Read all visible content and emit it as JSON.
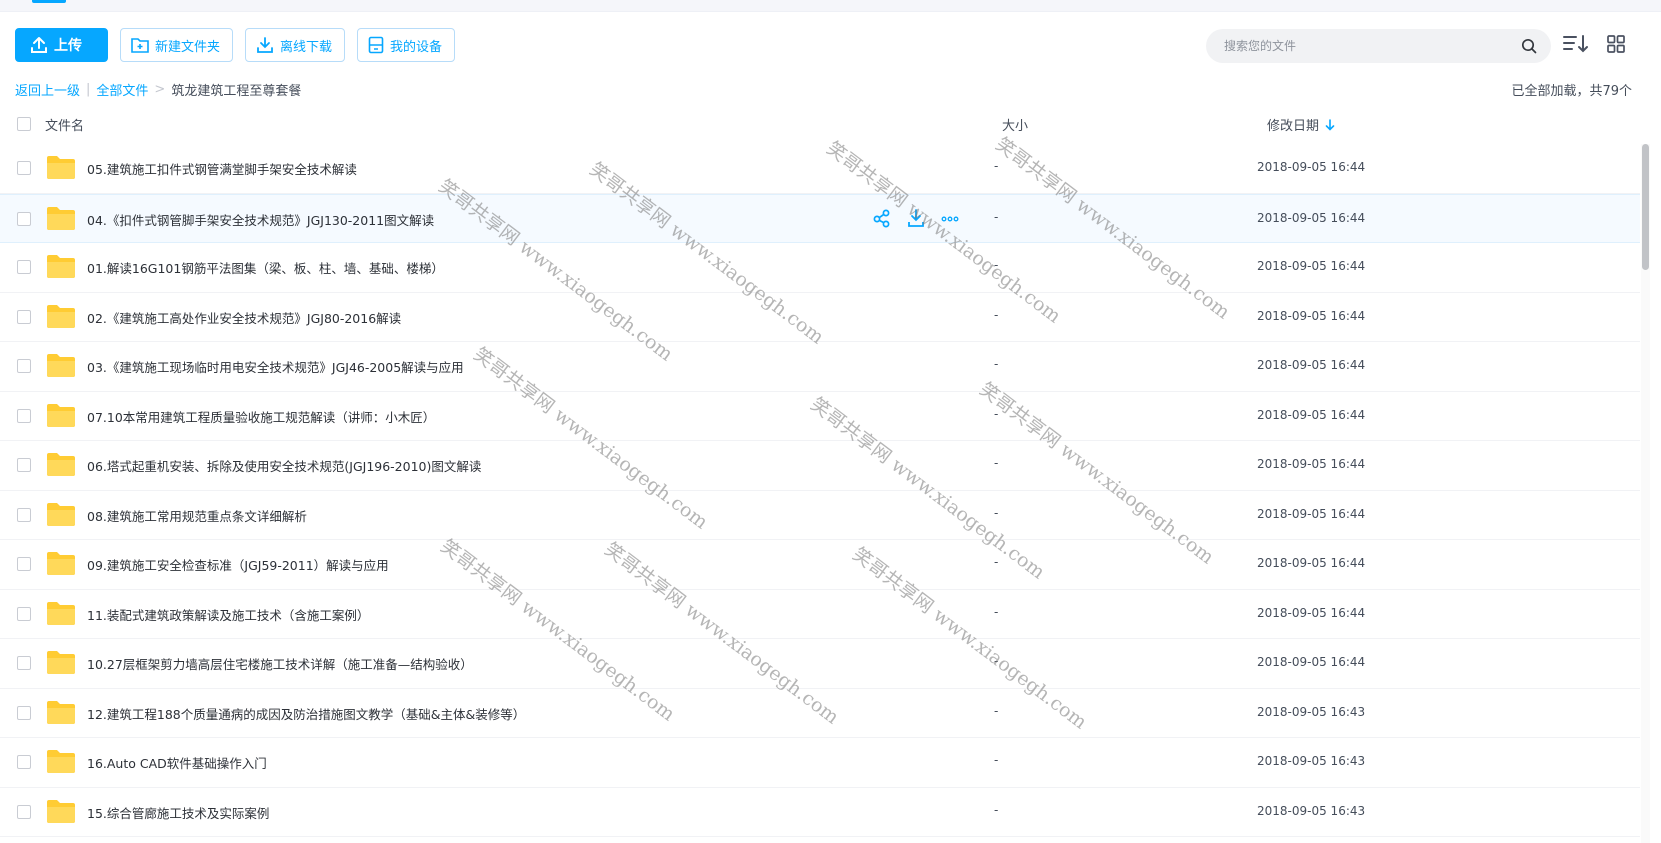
{
  "toolbar": {
    "upload_label": "上传",
    "new_folder_label": "新建文件夹",
    "offline_download_label": "离线下载",
    "my_devices_label": "我的设备"
  },
  "search": {
    "placeholder": "搜索您的文件"
  },
  "breadcrumb": {
    "back_label": "返回上一级",
    "separator": "|",
    "root_label": "全部文件",
    "arrow": ">",
    "current_label": "筑龙建筑工程至尊套餐"
  },
  "loaded_info": "已全部加载，共79个",
  "columns": {
    "name": "文件名",
    "size": "大小",
    "date": "修改日期"
  },
  "rows": [
    {
      "name": "05.建筑施工扣件式钢管满堂脚手架安全技术解读",
      "size": "-",
      "date": "2018-09-05 16:44"
    },
    {
      "name": "04.《扣件式钢管脚手架安全技术规范》JGJ130-2011图文解读",
      "size": "-",
      "date": "2018-09-05 16:44"
    },
    {
      "name": "01.解读16G101钢筋平法图集（梁、板、柱、墙、基础、楼梯）",
      "size": "-",
      "date": "2018-09-05 16:44"
    },
    {
      "name": "02.《建筑施工高处作业安全技术规范》JGJ80-2016解读",
      "size": "-",
      "date": "2018-09-05 16:44"
    },
    {
      "name": "03.《建筑施工现场临时用电安全技术规范》JGJ46-2005解读与应用",
      "size": "-",
      "date": "2018-09-05 16:44"
    },
    {
      "name": "07.10本常用建筑工程质量验收施工规范解读（讲师：小木匠）",
      "size": "-",
      "date": "2018-09-05 16:44"
    },
    {
      "name": "06.塔式起重机安装、拆除及使用安全技术规范(JGJ196-2010)图文解读",
      "size": "-",
      "date": "2018-09-05 16:44"
    },
    {
      "name": "08.建筑施工常用规范重点条文详细解析",
      "size": "-",
      "date": "2018-09-05 16:44"
    },
    {
      "name": "09.建筑施工安全检查标准（JGJ59-2011）解读与应用",
      "size": "-",
      "date": "2018-09-05 16:44"
    },
    {
      "name": "11.装配式建筑政策解读及施工技术（含施工案例）",
      "size": "-",
      "date": "2018-09-05 16:44"
    },
    {
      "name": "10.27层框架剪力墙高层住宅楼施工技术详解（施工准备—结构验收）",
      "size": "-",
      "date": "2018-09-05 16:44"
    },
    {
      "name": "12.建筑工程188个质量通病的成因及防治措施图文教学（基础&主体&装修等）",
      "size": "-",
      "date": "2018-09-05 16:43"
    },
    {
      "name": "16.Auto CAD软件基础操作入门",
      "size": "-",
      "date": "2018-09-05 16:43"
    },
    {
      "name": "15.综合管廊施工技术及实际案例",
      "size": "-",
      "date": "2018-09-05 16:43"
    }
  ],
  "watermark": "笑哥共享网 www.xiaogegh.com",
  "icons": {
    "upload": "upload-icon",
    "new_folder": "folder-plus-icon",
    "download": "download-icon",
    "device": "device-icon",
    "search": "search-icon",
    "sort": "sort-icon",
    "grid": "grid-view-icon",
    "folder": "folder-icon",
    "share": "share-icon",
    "more": "more-icon",
    "sort_desc": "arrow-down-icon"
  },
  "colors": {
    "accent": "#06a7ff",
    "folder": "#ffcc33"
  }
}
